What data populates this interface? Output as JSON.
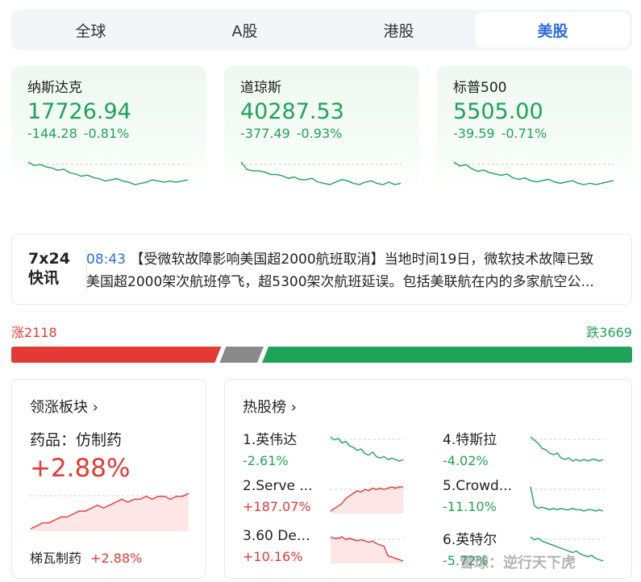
{
  "tabs": [
    "全球",
    "A股",
    "港股",
    "美股"
  ],
  "indices": [
    {
      "name": "纳斯达克",
      "price": "17726.94",
      "change": "-144.28",
      "pct": "-0.81%",
      "spark": [
        2,
        5,
        4,
        6,
        7,
        9,
        8,
        11,
        12,
        14,
        13,
        15,
        16,
        18,
        17,
        16,
        18,
        19,
        21,
        20,
        19,
        17,
        18,
        19,
        18,
        19,
        18,
        17
      ]
    },
    {
      "name": "道琼斯",
      "price": "40287.53",
      "change": "-377.49",
      "pct": "-0.93%",
      "spark": [
        2,
        8,
        9,
        9,
        10,
        12,
        12,
        13,
        15,
        14,
        16,
        16,
        15,
        18,
        19,
        20,
        18,
        16,
        17,
        19,
        20,
        18,
        17,
        19,
        20,
        18,
        20,
        19
      ]
    },
    {
      "name": "标普500",
      "price": "5505.00",
      "change": "-39.59",
      "pct": "-0.71%",
      "spark": [
        3,
        6,
        5,
        8,
        10,
        9,
        11,
        12,
        13,
        12,
        15,
        16,
        15,
        17,
        18,
        17,
        16,
        18,
        19,
        18,
        17,
        19,
        20,
        19,
        20,
        19,
        18,
        17
      ]
    }
  ],
  "news": {
    "logo_line1": "7x24",
    "logo_line2": "快讯",
    "time": "08:43",
    "line1": "【受微软故障影响美国超2000航班取消】当地时间19日，微软技术故障已致",
    "line2": "美国超2000架次航班停飞，超5300架次航班延误。包括美联航在内的多家航空公..."
  },
  "breadth": {
    "up": "涨2118",
    "down": "跌3669",
    "up_n": 2118,
    "flat_n": 380,
    "down_n": 3669
  },
  "sector": {
    "title": "领涨板块",
    "arrow": "›",
    "name": "药品：仿制药",
    "pct": "+2.88%",
    "stock": "梯瓦制药",
    "stock_pct": "+2.88%",
    "spark": [
      20,
      19,
      18,
      18,
      17,
      16,
      16,
      15,
      14,
      14,
      13,
      12,
      13,
      12,
      11,
      10,
      11,
      10,
      10,
      9,
      10,
      9,
      9,
      10,
      9,
      9,
      8
    ]
  },
  "hot": {
    "title": "热股榜",
    "arrow": "›",
    "items": [
      {
        "name": "1.英伟达",
        "pct": "-2.61%",
        "dir": "down",
        "spark": [
          3,
          5,
          4,
          7,
          6,
          9,
          10,
          12,
          11,
          14,
          15,
          13,
          16,
          17,
          16,
          18,
          17,
          18,
          19,
          18
        ]
      },
      {
        "name": "4.特斯拉",
        "pct": "-4.02%",
        "dir": "down",
        "spark": [
          2,
          4,
          6,
          9,
          10,
          12,
          13,
          12,
          15,
          16,
          15,
          17,
          16,
          17,
          16,
          17,
          16,
          16,
          17,
          16
        ]
      },
      {
        "name": "2.Serve ...",
        "pct": "+187.07%",
        "dir": "up",
        "spark": [
          24,
          22,
          20,
          18,
          14,
          12,
          10,
          8,
          9,
          7,
          8,
          6,
          7,
          6,
          7,
          6,
          5,
          6,
          5,
          5
        ]
      },
      {
        "name": "5.Crowd...",
        "pct": "-11.10%",
        "dir": "down",
        "spark": [
          2,
          16,
          18,
          17,
          18,
          19,
          18,
          19,
          18,
          19,
          19,
          18,
          19,
          19,
          20,
          19,
          19,
          20,
          19,
          20
        ]
      },
      {
        "name": "3.60 Deg...",
        "pct": "+10.16%",
        "dir": "up",
        "spark": [
          4,
          5,
          5,
          4,
          6,
          5,
          6,
          7,
          6,
          7,
          8,
          7,
          9,
          10,
          11,
          18,
          19,
          20,
          21,
          22
        ]
      },
      {
        "name": "6.英特尔",
        "pct": "-5.72%",
        "dir": "down",
        "spark": [
          3,
          5,
          4,
          6,
          7,
          8,
          9,
          10,
          11,
          12,
          13,
          14,
          13,
          15,
          16,
          17,
          16,
          18,
          19,
          20
        ]
      }
    ]
  },
  "watermark": "雪球：逆行天下虎",
  "colors": {
    "up": "#e53935",
    "down": "#1fa35a",
    "flat": "#8a8a8a",
    "accent": "#2d6cdf"
  }
}
